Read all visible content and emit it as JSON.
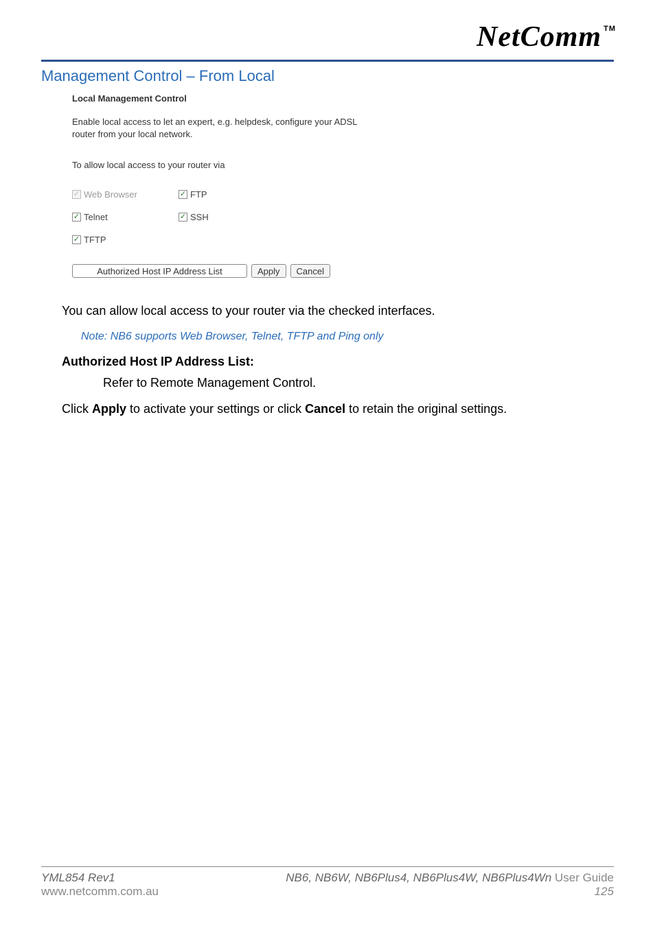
{
  "brand": "NetComm",
  "trademark": "TM",
  "section_title": "Management Control – From Local",
  "screenshot": {
    "heading": "Local Management Control",
    "description": "Enable local access to let an expert, e.g. helpdesk, configure your ADSL router from your local network.",
    "subtext": "To allow local access to your router via",
    "checkboxes": {
      "web_browser": "Web Browser",
      "ftp": "FTP",
      "telnet": "Telnet",
      "ssh": "SSH",
      "tftp": "TFTP"
    },
    "buttons": {
      "host_list": "Authorized Host IP Address List",
      "apply": "Apply",
      "cancel": "Cancel"
    }
  },
  "body": {
    "p1": "You can allow local access to your router via the checked interfaces.",
    "note": "Note: NB6 supports Web Browser, Telnet, TFTP and Ping only",
    "h2": "Authorized Host IP Address List:",
    "p2": "Refer to Remote Management Control.",
    "p3_a": "Click ",
    "p3_b_bold": "Apply",
    "p3_c": " to activate your settings or click ",
    "p3_d_bold": "Cancel",
    "p3_e": " to retain the original settings."
  },
  "footer": {
    "doc_id": "YML854 Rev1",
    "url": "www.netcomm.com.au",
    "models": "NB6, NB6W, NB6Plus4, NB6Plus4W, NB6Plus4Wn",
    "guide": " User Guide",
    "page": "125"
  }
}
